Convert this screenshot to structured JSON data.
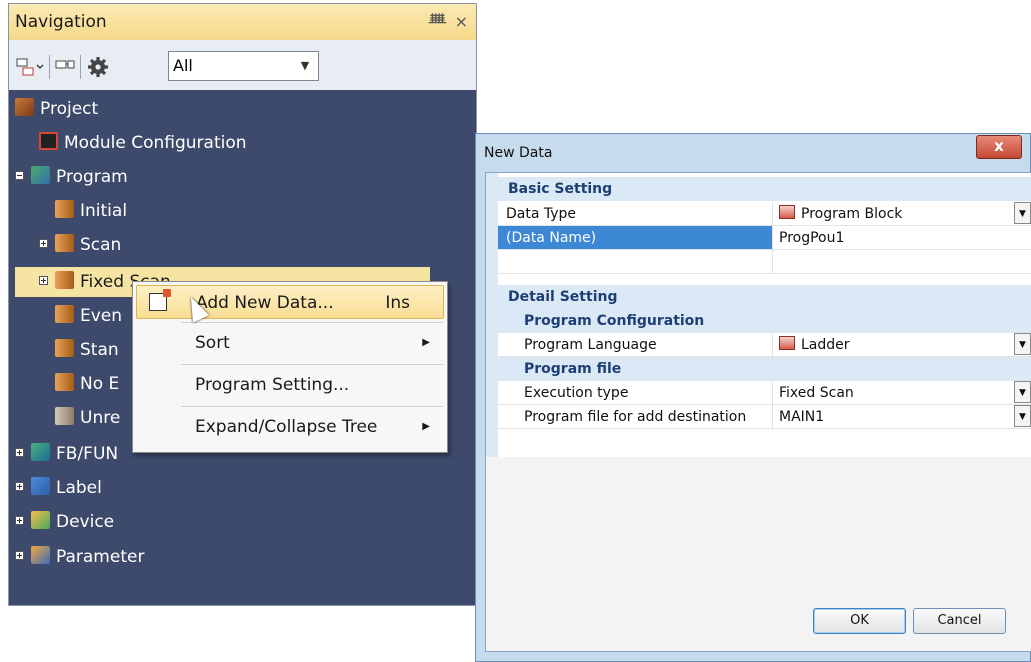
{
  "navigation": {
    "title": "Navigation",
    "pin_glyph": "ᅟ",
    "close_glyph": "×",
    "filter_value": "All",
    "tree": [
      {
        "label": "Project",
        "icon": "project-icon"
      },
      {
        "label": "Module Configuration",
        "icon": "module-config-icon"
      },
      {
        "label": "Program",
        "icon": "program-icon"
      },
      {
        "label": "Initial",
        "icon": "pou-icon"
      },
      {
        "label": "Scan",
        "icon": "pou-icon"
      },
      {
        "label": "Fixed Scan",
        "icon": "pou-icon"
      },
      {
        "label": "Even",
        "icon": "pou-icon"
      },
      {
        "label": "Stan",
        "icon": "pou-icon"
      },
      {
        "label": "No E",
        "icon": "pou-icon"
      },
      {
        "label": "Unre",
        "icon": "unregistered-icon"
      },
      {
        "label": "FB/FUN",
        "icon": "fb-icon"
      },
      {
        "label": "Label",
        "icon": "label-icon"
      },
      {
        "label": "Device",
        "icon": "device-icon"
      },
      {
        "label": "Parameter",
        "icon": "parameter-icon"
      }
    ]
  },
  "context_menu": {
    "items": [
      {
        "label": "Add New Data...",
        "shortcut": "Ins"
      },
      {
        "label": "Sort"
      },
      {
        "label": "Program Setting..."
      },
      {
        "label": "Expand/Collapse Tree"
      }
    ]
  },
  "dialog": {
    "title": "New Data",
    "close_glyph": "x",
    "basic_setting": "Basic Setting",
    "data_type_label": "Data Type",
    "data_type_value": "Program Block",
    "data_name_label": "(Data Name)",
    "data_name_value": "ProgPou1",
    "detail_setting": "Detail Setting",
    "program_configuration": "Program Configuration",
    "program_language_label": "Program Language",
    "program_language_value": "Ladder",
    "program_file": "Program file",
    "execution_type_label": "Execution type",
    "execution_type_value": "Fixed Scan",
    "program_file_dest_label": "Program file for add destination",
    "program_file_dest_value": "MAIN1",
    "ok_label": "OK",
    "cancel_label": "Cancel"
  },
  "colors": {
    "nav_background": "#3d4a6b",
    "title_bar": "#f6d98a",
    "selected_row": "#f6e5a2",
    "grid_selection": "#3d88d5",
    "dialog_frame": "#c7dbef"
  }
}
